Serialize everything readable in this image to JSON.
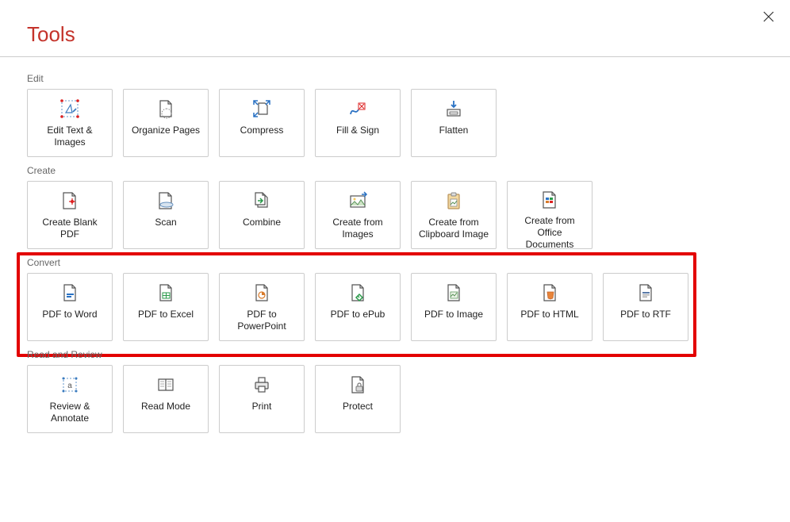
{
  "pageTitle": "Tools",
  "sections": {
    "edit": {
      "label": "Edit",
      "items": [
        {
          "label": "Edit Text & Images"
        },
        {
          "label": "Organize Pages"
        },
        {
          "label": "Compress"
        },
        {
          "label": "Fill & Sign"
        },
        {
          "label": "Flatten"
        }
      ]
    },
    "create": {
      "label": "Create",
      "items": [
        {
          "label": "Create Blank PDF"
        },
        {
          "label": "Scan"
        },
        {
          "label": "Combine"
        },
        {
          "label": "Create from Images"
        },
        {
          "label": "Create from Clipboard Image"
        },
        {
          "label": "Create from Office Documents"
        }
      ]
    },
    "convert": {
      "label": "Convert",
      "items": [
        {
          "label": "PDF to Word"
        },
        {
          "label": "PDF to Excel"
        },
        {
          "label": "PDF to PowerPoint"
        },
        {
          "label": "PDF to ePub"
        },
        {
          "label": "PDF to Image"
        },
        {
          "label": "PDF to HTML"
        },
        {
          "label": "PDF to RTF"
        }
      ]
    },
    "read": {
      "label": "Read and Review",
      "items": [
        {
          "label": "Review & Annotate"
        },
        {
          "label": "Read Mode"
        },
        {
          "label": "Print"
        },
        {
          "label": "Protect"
        }
      ]
    }
  }
}
